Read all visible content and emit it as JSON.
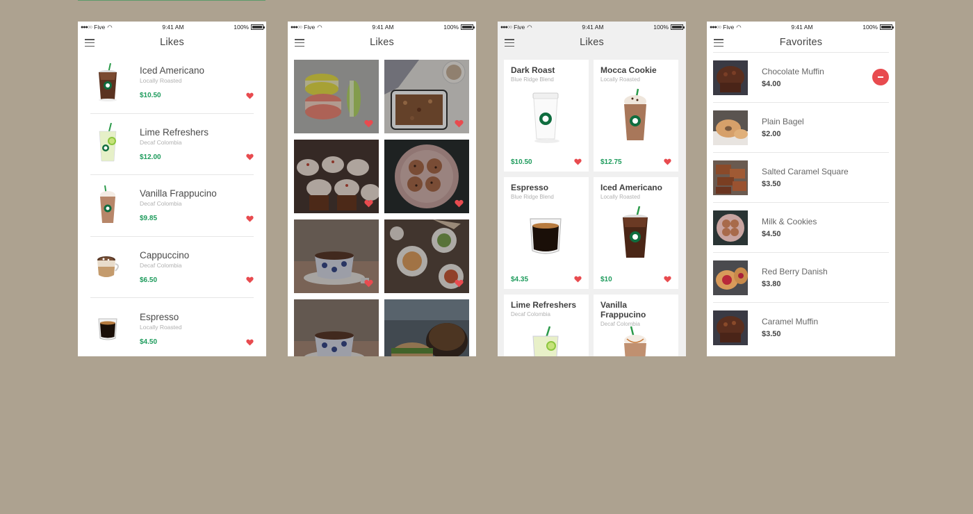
{
  "status": {
    "carrier": "Five",
    "time": "9:41 AM",
    "battery": "100%"
  },
  "screens": {
    "likes_list": {
      "title": "Likes",
      "items": [
        {
          "name": "Iced Americano",
          "origin": "Locally Roasted",
          "price": "$10.50"
        },
        {
          "name": "Lime Refreshers",
          "origin": "Decaf Colombia",
          "price": "$12.00"
        },
        {
          "name": "Vanilla Frappucino",
          "origin": "Decaf Colombia",
          "price": "$9.85"
        },
        {
          "name": "Cappuccino",
          "origin": "Decaf Colombia",
          "price": "$6.50"
        },
        {
          "name": "Espresso",
          "origin": "Locally Roasted",
          "price": "$4.50"
        }
      ]
    },
    "likes_grid": {
      "title": "Likes",
      "tiles": [
        "Macarons",
        "Granola",
        "Cupcakes",
        "Cookies",
        "Teacup",
        "Breakfast table",
        "Teacup",
        "Burger"
      ]
    },
    "likes_cards": {
      "title": "Likes",
      "cards": [
        {
          "name": "Dark Roast",
          "origin": "Blue Ridge Blend",
          "price": "$10.50"
        },
        {
          "name": "Mocca Cookie",
          "origin": "Locally Roasted",
          "price": "$12.75"
        },
        {
          "name": "Espresso",
          "origin": "Blue Ridge Blend",
          "price": "$4.35"
        },
        {
          "name": "Iced Americano",
          "origin": "Locally Roasted",
          "price": "$10"
        },
        {
          "name": "Lime Refreshers",
          "origin": "Decaf Colombia",
          "price": ""
        },
        {
          "name": "Vanilla Frappucino",
          "origin": "Decaf Colombia",
          "price": ""
        }
      ]
    },
    "favorites": {
      "title": "Favorites",
      "items": [
        {
          "name": "Chocolate Muffin",
          "price": "$4.00"
        },
        {
          "name": "Plain Bagel",
          "price": "$2.00"
        },
        {
          "name": "Salted Caramel Square",
          "price": "$3.50"
        },
        {
          "name": "Milk & Cookies",
          "price": "$4.50"
        },
        {
          "name": "Red Berry Danish",
          "price": "$3.80"
        },
        {
          "name": "Caramel Muffin",
          "price": "$3.50"
        }
      ]
    }
  },
  "colors": {
    "background": "#ada290",
    "price_green": "#1e9b5c",
    "heart_red": "#e84b4f"
  }
}
